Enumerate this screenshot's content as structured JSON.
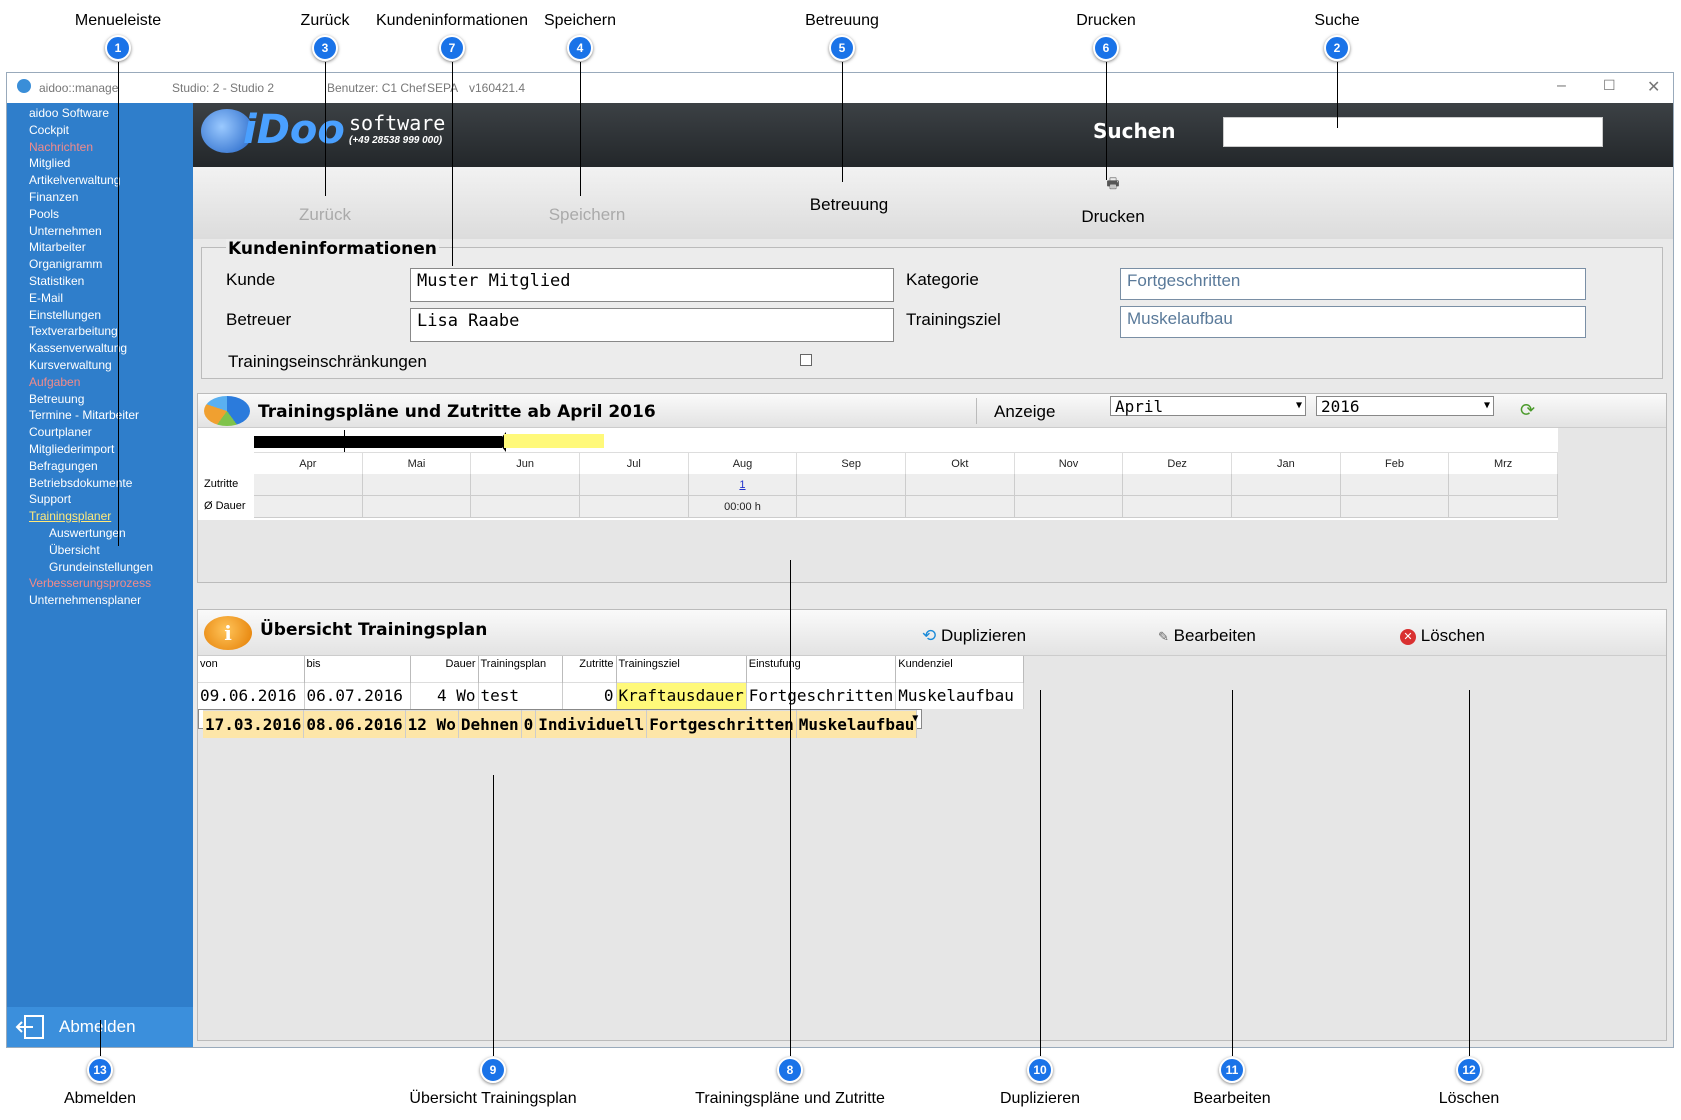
{
  "callouts": {
    "top": [
      {
        "n": "1",
        "label": "Menueleiste"
      },
      {
        "n": "3",
        "label": "Zurück"
      },
      {
        "n": "7",
        "label": "Kundeninformationen"
      },
      {
        "n": "4",
        "label": "Speichern"
      },
      {
        "n": "5",
        "label": "Betreuung"
      },
      {
        "n": "6",
        "label": "Drucken"
      },
      {
        "n": "2",
        "label": "Suche"
      }
    ],
    "bottom": [
      {
        "n": "13",
        "label": "Abmelden"
      },
      {
        "n": "9",
        "label": "Übersicht Trainingsplan"
      },
      {
        "n": "8",
        "label": "Trainingspläne und Zutritte"
      },
      {
        "n": "10",
        "label": "Duplizieren"
      },
      {
        "n": "11",
        "label": "Bearbeiten"
      },
      {
        "n": "12",
        "label": "Löschen"
      }
    ]
  },
  "titlebar": {
    "app": "aidoo::manage",
    "studio": "Studio: 2 - Studio 2",
    "user": "Benutzer: C1 Chef",
    "sepa": "SEPA",
    "version": "v160421.4"
  },
  "sidebar": {
    "items": [
      {
        "label": "aidoo Software",
        "style": "normal"
      },
      {
        "label": "Cockpit",
        "style": "normal"
      },
      {
        "label": "Nachrichten",
        "style": "red"
      },
      {
        "label": "Mitglied",
        "style": "normal"
      },
      {
        "label": "Artikelverwaltung",
        "style": "normal"
      },
      {
        "label": "Finanzen",
        "style": "normal"
      },
      {
        "label": "Pools",
        "style": "normal"
      },
      {
        "label": "Unternehmen",
        "style": "normal"
      },
      {
        "label": "Mitarbeiter",
        "style": "normal"
      },
      {
        "label": "Organigramm",
        "style": "normal"
      },
      {
        "label": "Statistiken",
        "style": "normal"
      },
      {
        "label": "E-Mail",
        "style": "normal"
      },
      {
        "label": "Einstellungen",
        "style": "normal"
      },
      {
        "label": "Textverarbeitung",
        "style": "normal"
      },
      {
        "label": "Kassenverwaltung",
        "style": "normal"
      },
      {
        "label": "Kursverwaltung",
        "style": "normal"
      },
      {
        "label": "Aufgaben",
        "style": "red"
      },
      {
        "label": "Betreuung",
        "style": "normal"
      },
      {
        "label": "Termine - Mitarbeiter",
        "style": "normal"
      },
      {
        "label": "Courtplaner",
        "style": "normal"
      },
      {
        "label": "Mitgliederimport",
        "style": "normal"
      },
      {
        "label": "Befragungen",
        "style": "normal"
      },
      {
        "label": "Betriebsdokumente",
        "style": "normal"
      },
      {
        "label": "Support",
        "style": "normal"
      },
      {
        "label": "Trainingsplaner",
        "style": "yellow"
      },
      {
        "label": "Auswertungen",
        "style": "sub"
      },
      {
        "label": "Übersicht",
        "style": "sub"
      },
      {
        "label": "Grundeinstellungen",
        "style": "sub"
      },
      {
        "label": "Verbesserungsprozess",
        "style": "red"
      },
      {
        "label": "Unternehmensplaner",
        "style": "normal"
      }
    ],
    "logout_label": "Abmelden"
  },
  "header": {
    "logo_text": "iDoo",
    "logo_software": "software",
    "logo_phone": "(+49 28538 999 000)",
    "search_label": "Suchen",
    "search_value": ""
  },
  "toolbar": {
    "back": "Zurück",
    "save": "Speichern",
    "care": "Betreuung",
    "print": "Drucken"
  },
  "customer": {
    "title": "Kundeninformationen",
    "kunde_label": "Kunde",
    "kunde_value": "Muster Mitglied",
    "betreuer_label": "Betreuer",
    "betreuer_value": "Lisa Raabe",
    "kategorie_label": "Kategorie",
    "kategorie_value": "Fortgeschritten",
    "ziel_label": "Trainingsziel",
    "ziel_value": "Muskelaufbau",
    "einschr_label": "Trainingseinschränkungen"
  },
  "plans": {
    "title": "Trainingspläne und Zutritte ab April 2016",
    "anzeige_label": "Anzeige",
    "month_value": "April",
    "year_value": "2016",
    "months": [
      "Apr",
      "Mai",
      "Jun",
      "Jul",
      "Aug",
      "Sep",
      "Okt",
      "Nov",
      "Dez",
      "Jan",
      "Feb",
      "Mrz"
    ],
    "row_zutritte": "Zutritte",
    "row_dauer": "Ø Dauer",
    "zutritte_aug": "1",
    "dauer_aug": "00:00 h"
  },
  "overview": {
    "title": "Übersicht Trainingsplan",
    "duplicate": "Duplizieren",
    "edit": "Bearbeiten",
    "delete": "Löschen",
    "columns": [
      "von",
      "bis",
      "Dauer",
      "Trainingsplan",
      "Zutritte",
      "Trainingsziel",
      "Einstufung",
      "Kundenziel"
    ],
    "rows": [
      {
        "von": "09.06.2016",
        "bis": "06.07.2016",
        "dauer": "4 Wo",
        "plan": "test",
        "zutritte": "0",
        "ziel": "Kraftausdauer",
        "einstufung": "Fortgeschritten",
        "kundenziel": "Muskelaufbau"
      },
      {
        "von": "17.03.2016",
        "bis": "08.06.2016",
        "dauer": "12 Wo",
        "plan": "Dehnen",
        "zutritte": "0",
        "ziel": "Individuell",
        "einstufung": "Fortgeschritten",
        "kundenziel": "Muskelaufbau"
      }
    ]
  }
}
